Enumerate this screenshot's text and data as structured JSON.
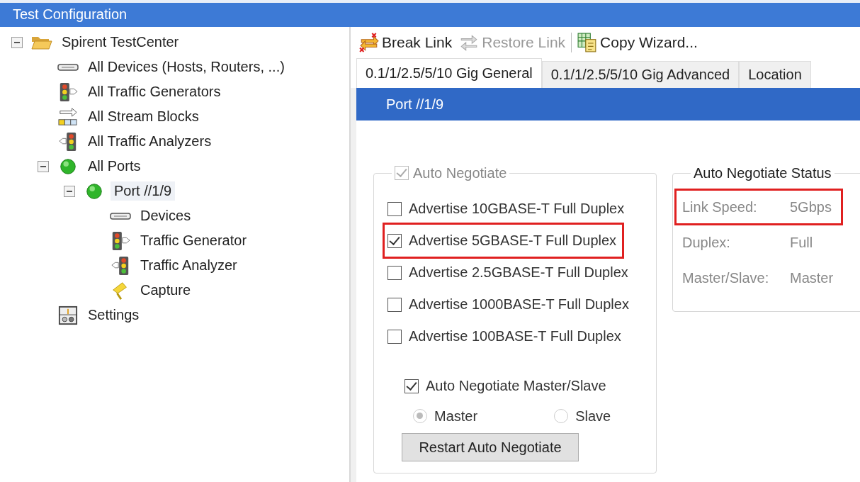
{
  "window": {
    "title": "Test Configuration"
  },
  "tree": [
    {
      "label": "Spirent TestCenter",
      "kind": "folder",
      "expanded": true,
      "selected": false,
      "children": [
        {
          "label": "All Devices (Hosts, Routers, ...)",
          "kind": "device",
          "selected": false
        },
        {
          "label": "All Traffic Generators",
          "kind": "generator",
          "selected": false
        },
        {
          "label": "All Stream Blocks",
          "kind": "stream",
          "selected": false
        },
        {
          "label": "All Traffic Analyzers",
          "kind": "analyzer",
          "selected": false
        },
        {
          "label": "All Ports",
          "kind": "port",
          "expanded": true,
          "selected": false,
          "children": [
            {
              "label": "Port //1/9",
              "kind": "port",
              "expanded": true,
              "selected": true,
              "children": [
                {
                  "label": "Devices",
                  "kind": "device",
                  "selected": false
                },
                {
                  "label": "Traffic Generator",
                  "kind": "generator",
                  "selected": false
                },
                {
                  "label": "Traffic Analyzer",
                  "kind": "analyzer",
                  "selected": false
                },
                {
                  "label": "Capture",
                  "kind": "capture",
                  "selected": false
                }
              ]
            }
          ]
        },
        {
          "label": "Settings",
          "kind": "settings",
          "selected": false
        }
      ]
    }
  ],
  "toolbar": [
    {
      "label": "Break Link",
      "kind": "break",
      "disabled": false
    },
    {
      "label": "Restore Link",
      "kind": "restore",
      "disabled": true
    },
    {
      "label": "Copy Wizard...",
      "kind": "copy",
      "disabled": false
    }
  ],
  "tabs": [
    {
      "label": "0.1/1/2.5/5/10 Gig General",
      "selected": true
    },
    {
      "label": "0.1/1/2.5/5/10 Gig Advanced",
      "selected": false
    },
    {
      "label": "Location",
      "selected": false
    }
  ],
  "header": "Port //1/9",
  "auto_negotiate": {
    "label": "Auto Negotiate",
    "checked": true,
    "disabled": true,
    "options": [
      {
        "label": "Advertise 10GBASE-T Full Duplex",
        "checked": false,
        "highlighted": false
      },
      {
        "label": "Advertise 5GBASE-T Full Duplex",
        "checked": true,
        "highlighted": true
      },
      {
        "label": "Advertise 2.5GBASE-T Full Duplex",
        "checked": false,
        "highlighted": false
      },
      {
        "label": "Advertise 1000BASE-T Full Duplex",
        "checked": false,
        "highlighted": false
      },
      {
        "label": "Advertise 100BASE-T Full Duplex",
        "checked": false,
        "highlighted": false
      }
    ],
    "master_slave": {
      "label": "Auto Negotiate Master/Slave",
      "checked": true
    },
    "radios": [
      {
        "label": "Master",
        "selected": true,
        "disabled": true
      },
      {
        "label": "Slave",
        "selected": false,
        "disabled": true
      }
    ],
    "button": "Restart Auto Negotiate"
  },
  "status": {
    "title": "Auto Negotiate Status",
    "rows": [
      {
        "label": "Link Speed:",
        "value": "5Gbps",
        "highlighted": true
      },
      {
        "label": "Duplex:",
        "value": "Full",
        "highlighted": false
      },
      {
        "label": "Master/Slave:",
        "value": "Master",
        "highlighted": false
      }
    ]
  }
}
